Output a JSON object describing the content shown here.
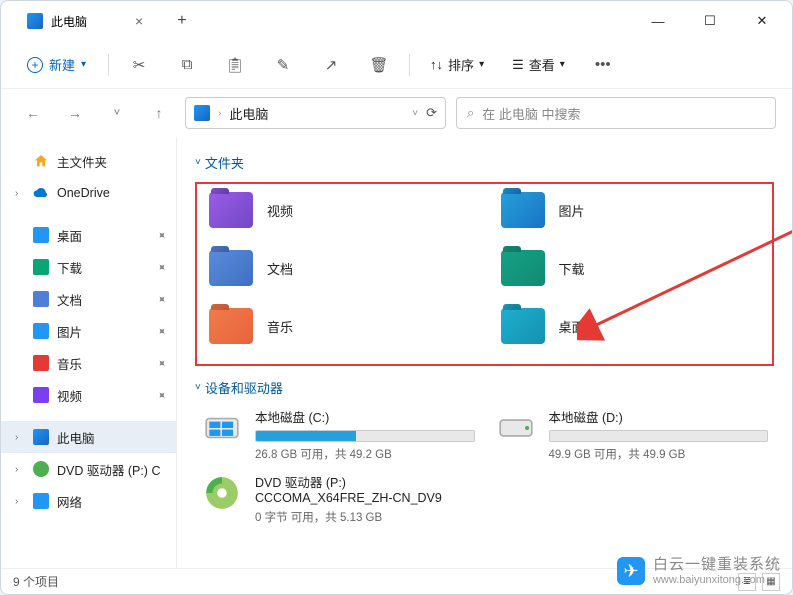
{
  "title": "此电脑",
  "toolbar": {
    "new_label": "新建",
    "sort_label": "排序",
    "view_label": "查看"
  },
  "address": {
    "path": "此电脑"
  },
  "search": {
    "placeholder": "在 此电脑 中搜索"
  },
  "sidebar": {
    "home": "主文件夹",
    "onedrive": "OneDrive",
    "quick": [
      {
        "label": "桌面",
        "color": "#2196f3"
      },
      {
        "label": "下载",
        "color": "#0aa574"
      },
      {
        "label": "文档",
        "color": "#4f7ed6"
      },
      {
        "label": "图片",
        "color": "#2196f3"
      },
      {
        "label": "音乐",
        "color": "#e53935"
      },
      {
        "label": "视频",
        "color": "#7b3ff2"
      }
    ],
    "thispc": "此电脑",
    "dvd": "DVD 驱动器 (P:) C",
    "network": "网络"
  },
  "sections": {
    "folders": "文件夹",
    "drives": "设备和驱动器"
  },
  "folders": [
    {
      "label": "视频",
      "color1": "#9b5de5",
      "color2": "#7048c6"
    },
    {
      "label": "图片",
      "color1": "#26a0da",
      "color2": "#1a73c7"
    },
    {
      "label": "文档",
      "color1": "#5b8bd9",
      "color2": "#3f6fc3"
    },
    {
      "label": "下载",
      "color1": "#16a085",
      "color2": "#0f8c73"
    },
    {
      "label": "音乐",
      "color1": "#f07c4a",
      "color2": "#e8633a"
    },
    {
      "label": "桌面",
      "color1": "#1faecf",
      "color2": "#1492b0"
    }
  ],
  "drives": [
    {
      "name": "本地磁盘 (C:)",
      "sub": "26.8 GB 可用，共 49.2 GB",
      "fill": 46,
      "type": "os"
    },
    {
      "name": "本地磁盘 (D:)",
      "sub": "49.9 GB 可用，共 49.9 GB",
      "fill": 0,
      "type": "hdd"
    },
    {
      "name": "DVD 驱动器 (P:)\nCCCOMA_X64FRE_ZH-CN_DV9",
      "sub": "0 字节 可用，共 5.13 GB",
      "fill": null,
      "type": "dvd"
    }
  ],
  "status": "9 个项目",
  "watermark": {
    "big": "白云一键重装系统",
    "small": "www.baiyunxitong.com"
  }
}
